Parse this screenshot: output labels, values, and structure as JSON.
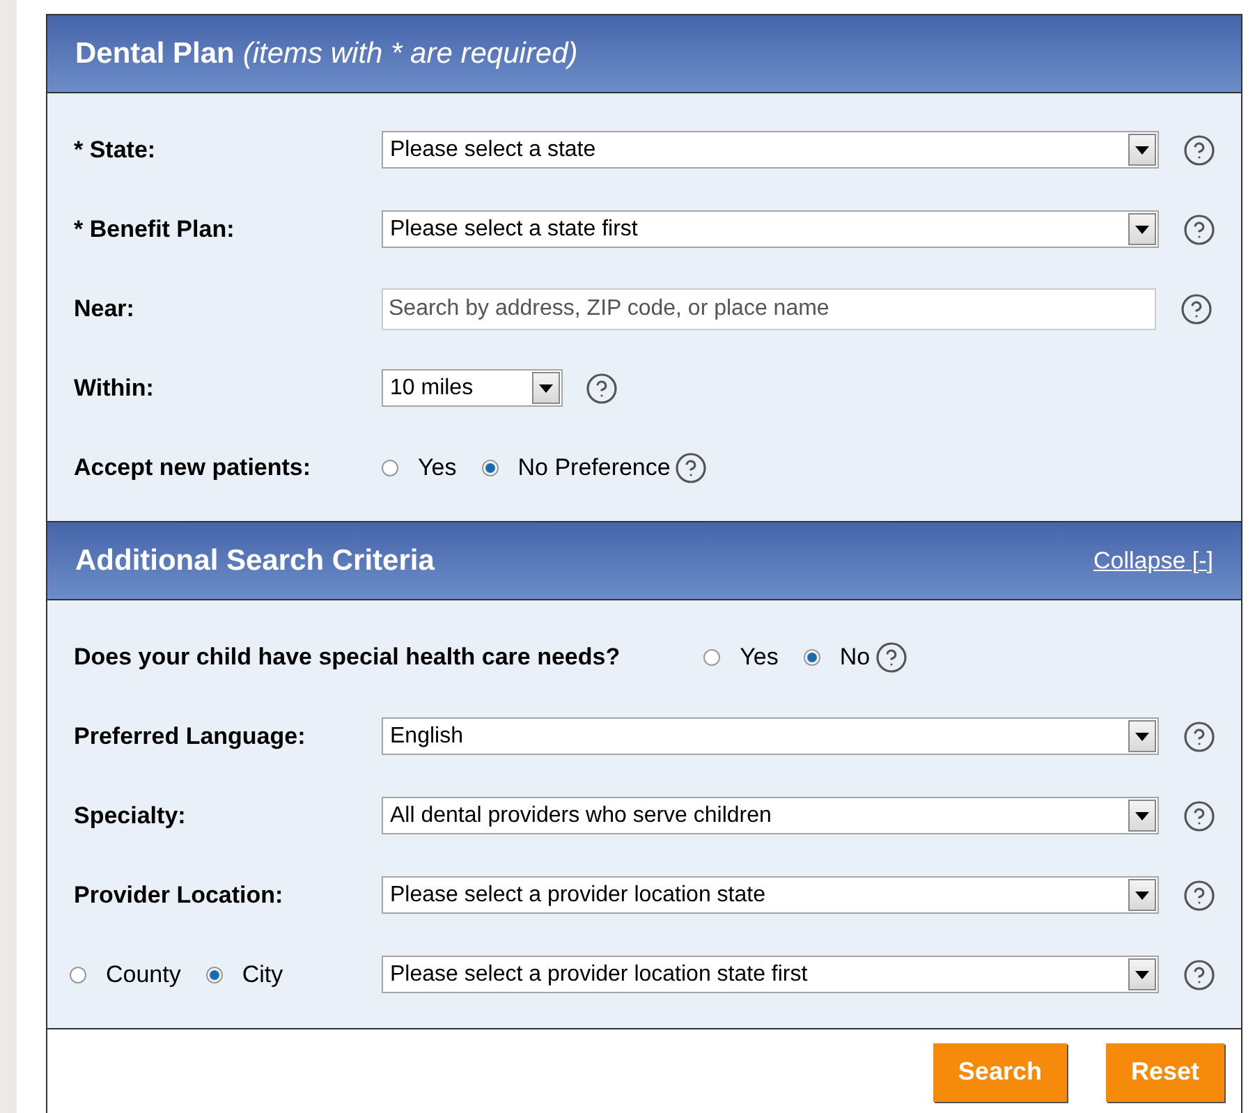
{
  "sections": [
    {
      "title": "Dental Plan",
      "note": "(items with * are required)",
      "rows": [
        {
          "kind": "select",
          "label": "* State:",
          "value": "Please select a state"
        },
        {
          "kind": "select",
          "label": "* Benefit Plan:",
          "value": "Please select a state first"
        },
        {
          "kind": "text",
          "label": "Near:",
          "placeholder": "Search by address, ZIP code, or place name"
        },
        {
          "kind": "short-select",
          "label": "Within:",
          "value": "10 miles"
        },
        {
          "kind": "radio",
          "label": "Accept new patients:",
          "options": [
            {
              "label": "Yes",
              "selected": false
            },
            {
              "label": "No Preference",
              "selected": true
            }
          ]
        }
      ]
    },
    {
      "title": "Additional Search Criteria",
      "link": "Collapse [-]",
      "rows": [
        {
          "kind": "radio",
          "label": "Does your child have special health care needs?",
          "options": [
            {
              "label": "Yes",
              "selected": false
            },
            {
              "label": "No",
              "selected": true
            }
          ]
        },
        {
          "kind": "select",
          "label": "Preferred Language:",
          "value": "English"
        },
        {
          "kind": "select",
          "label": "Specialty:",
          "value": "All dental providers who serve children"
        },
        {
          "kind": "select",
          "label": "Provider Location:",
          "value": "Please select a provider location state"
        },
        {
          "kind": "radio-select",
          "options": [
            {
              "label": "County",
              "selected": false
            },
            {
              "label": "City",
              "selected": true
            }
          ],
          "value": "Please select a provider location state first"
        }
      ]
    }
  ],
  "buttons": [
    "Search",
    "Reset"
  ]
}
